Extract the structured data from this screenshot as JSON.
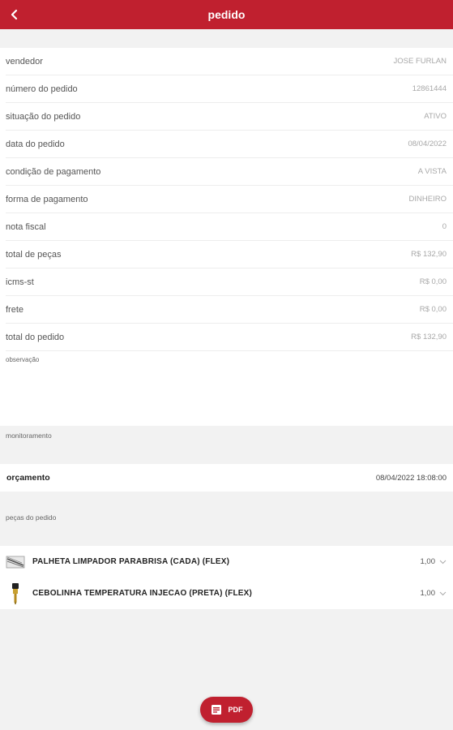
{
  "header": {
    "title": "pedido",
    "back_icon": "arrow-left-icon"
  },
  "details": [
    {
      "label": "vendedor",
      "value": "JOSE FURLAN"
    },
    {
      "label": "número do pedido",
      "value": "12861444"
    },
    {
      "label": "situação do pedido",
      "value": "ATIVO"
    },
    {
      "label": "data do pedido",
      "value": "08/04/2022"
    },
    {
      "label": "condição de pagamento",
      "value": "A VISTA"
    },
    {
      "label": "forma de pagamento",
      "value": "DINHEIRO"
    },
    {
      "label": "nota fiscal",
      "value": "0"
    },
    {
      "label": "total de peças",
      "value": "R$ 132,90"
    },
    {
      "label": "icms-st",
      "value": "R$ 0,00"
    },
    {
      "label": "frete",
      "value": "R$ 0,00"
    },
    {
      "label": "total do pedido",
      "value": "R$ 132,90"
    }
  ],
  "observation_label": "observação",
  "monitoring": {
    "section_label": "monitoramento",
    "events": [
      {
        "name": "orçamento",
        "datetime": "08/04/2022 18:08:00"
      }
    ]
  },
  "parts": {
    "section_label": "peças do pedido",
    "items": [
      {
        "name": "PALHETA LIMPADOR PARABRISA (CADA) (FLEX)",
        "qty": "1,00",
        "icon": "wiper-blade-icon"
      },
      {
        "name": "CEBOLINHA TEMPERATURA INJECAO (PRETA) (FLEX)",
        "qty": "1,00",
        "icon": "temperature-sensor-icon"
      }
    ]
  },
  "pdf_button": {
    "label": "PDF",
    "icon": "pdf-icon"
  },
  "colors": {
    "primary": "#c0202f",
    "background": "#f2f2f2",
    "value_text": "#a8a8a8"
  }
}
